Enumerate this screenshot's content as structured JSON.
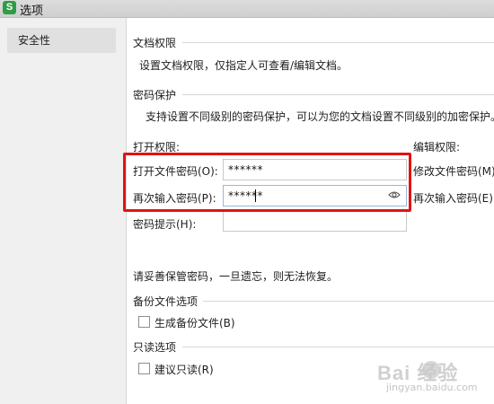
{
  "window": {
    "title": "选项",
    "app_icon": "S"
  },
  "sidebar": {
    "items": [
      {
        "label": "安全性"
      }
    ]
  },
  "doc_permission": {
    "title": "文档权限",
    "desc": "设置文档权限，仅指定人可查看/编辑文档。"
  },
  "password_protect": {
    "title": "密码保护",
    "desc": "支持设置不同级别的密码保护，可以为您的文档设置不同级别的加密保护。",
    "open_permission": "打开权限:",
    "edit_permission": "编辑权限:",
    "open_password_label": "打开文件密码(O):",
    "open_password_value": "******",
    "reenter_label": "再次输入密码(P):",
    "reenter_value": "******",
    "hint_label": "密码提示(H):",
    "hint_value": "",
    "modify_password_label": "修改文件密码(M)",
    "modify_reenter_label": "再次输入密码(E):",
    "warning": "请妥善保管密码，一旦遗忘，则无法恢复。"
  },
  "backup": {
    "title": "备份文件选项",
    "checkbox_label": "生成备份文件(B)",
    "checked": false
  },
  "readonly": {
    "title": "只读选项",
    "checkbox_label": "建议只读(R)",
    "checked": false
  },
  "watermark": {
    "text": "Bai  经验",
    "sub": "jingyan.baidu.com"
  },
  "colors": {
    "highlight": "#e11414",
    "sidebar_bg": "#f0f0f0",
    "app_icon": "#2e9d46"
  }
}
